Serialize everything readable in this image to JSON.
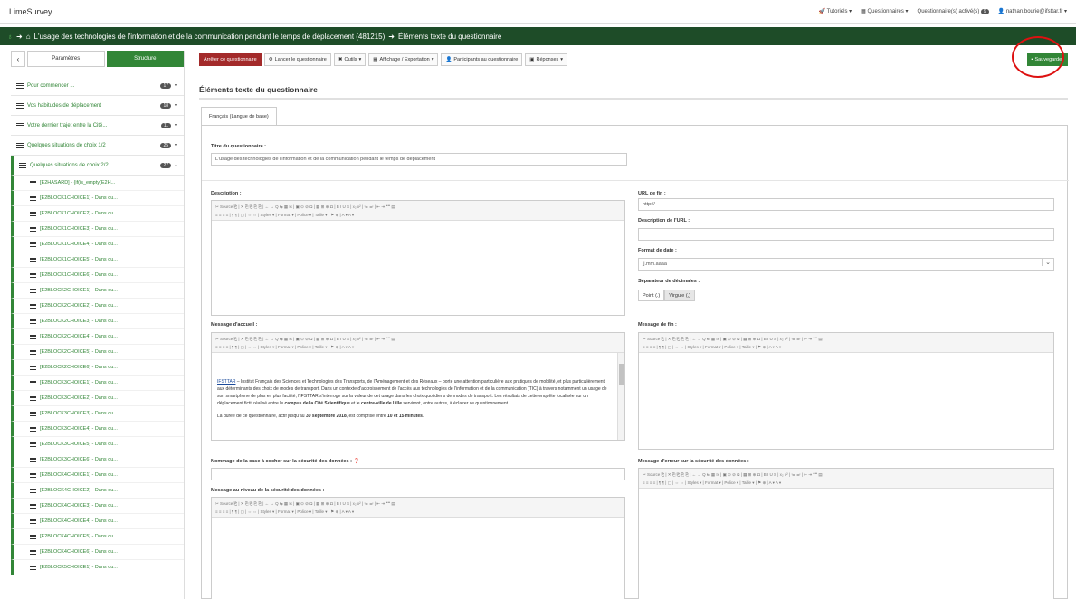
{
  "app": {
    "title": "LimeSurvey"
  },
  "topnav": {
    "tutorials": "Tutoriels",
    "surveys": "Questionnaires",
    "active": "Questionnaire(s) activé(s)",
    "active_count": "9",
    "user": "nathan.bourie@ifsttar.fr"
  },
  "breadcrumb": {
    "survey": "L'usage des technologies de l'information et de la communication pendant le temps de déplacement (481215)",
    "page": "Éléments texte du questionnaire"
  },
  "sidebar": {
    "tabs": [
      "Paramètres",
      "Structure"
    ],
    "groups": [
      {
        "label": "Pour commencer ...",
        "count": "17"
      },
      {
        "label": "Vos habitudes de déplacement",
        "count": "18"
      },
      {
        "label": "Votre dernier trajet entre la Cité...",
        "count": "11"
      },
      {
        "label": "Quelques situations de choix 1/2",
        "count": "25"
      },
      {
        "label": "Quelques situations de choix 2/2",
        "count": "27"
      }
    ],
    "questions": [
      "[E2HASARD] - {if(is_empty(E2H...",
      "[E2BLOCK1CHOICE1] - Dans qu...",
      "[E2BLOCK1CHOICE2] - Dans qu...",
      "[E2BLOCK1CHOICE3] - Dans qu...",
      "[E2BLOCK1CHOICE4] - Dans qu...",
      "[E2BLOCK1CHOICE5] - Dans qu...",
      "[E2BLOCK1CHOICE6] - Dans qu...",
      "[E2BLOCK2CHOICE1] - Dans qu...",
      "[E2BLOCK2CHOICE2] - Dans qu...",
      "[E2BLOCK2CHOICE3] - Dans qu...",
      "[E2BLOCK2CHOICE4] - Dans qu...",
      "[E2BLOCK2CHOICE5] - Dans qu...",
      "[E2BLOCK2CHOICE6] - Dans qu...",
      "[E2BLOCK3CHOICE1] - Dans qu...",
      "[E2BLOCK3CHOICE2] - Dans qu...",
      "[E2BLOCK3CHOICE3] - Dans qu...",
      "[E2BLOCK3CHOICE4] - Dans qu...",
      "[E2BLOCK3CHOICE5] - Dans qu...",
      "[E2BLOCK3CHOICE6] - Dans qu...",
      "[E2BLOCK4CHOICE1] - Dans qu...",
      "[E2BLOCK4CHOICE2] - Dans qu...",
      "[E2BLOCK4CHOICE3] - Dans qu...",
      "[E2BLOCK4CHOICE4] - Dans qu...",
      "[E2BLOCK4CHOICE5] - Dans qu...",
      "[E2BLOCK4CHOICE6] - Dans qu...",
      "[E2BLOCK5CHOICE1] - Dans qu..."
    ]
  },
  "toolbar": {
    "stop": "Arrêter ce questionnaire",
    "launch": "Lancer le questionnaire",
    "tools": "Outils",
    "display": "Affichage / Exportation",
    "participants": "Participants au questionnaire",
    "responses": "Réponses",
    "save": "Sauvegarder"
  },
  "main": {
    "section_title": "Éléments texte du questionnaire",
    "language_tab": "Français (Langue de base)",
    "title_label": "Titre du questionnaire :",
    "title_value": "L'usage des technologies de l'information et de la communication pendant le temps de déplacement",
    "description_label": "Description :",
    "end_url_label": "URL de fin :",
    "end_url_value": "http://",
    "url_desc_label": "Description de l'URL :",
    "date_format_label": "Format de date :",
    "date_format_value": "jj.mm.aaaa",
    "decimal_label": "Séparateur de décimales :",
    "decimal_point": "Point (.)",
    "decimal_comma": "Virgule (,)",
    "welcome_label": "Message d'accueil :",
    "end_message_label": "Message de fin :",
    "checkbox_label": "Nommage de la case à cocher sur la sécurité des données :",
    "security_message_label": "Message au niveau de la sécurité des données :",
    "security_error_label": "Message d'erreur sur la sécurité des données :"
  },
  "editor": {
    "row1": "✂ Source ⎗ | ✕ ⎘ ⎗ ⎘ ⎘ | ← → Q ⇆ ▦ Ix | ▣ ⊙ ⊘ Ω | ▦ ⊞ ⊕ Ω | B I U S | x₂ x² | ≔ ≕ | ⇤ ⇥ ❝❞ ▤",
    "row2": "≡ ≡ ≡ ≡ | ¶ ¶ | ▢ | ⇔ ⇔ | Styles ▾ | Format ▾ | Police ▾ | Taille ▾ | ⚑ ⊕ | A ▾ A ▾"
  },
  "welcome": {
    "link": "IFSTTAR",
    "p1": " – Institut Français des Sciences et Technologies des Transports, de l'Aménagement et des Réseaux – porte une attention particulière aux pratiques de mobilité, et plus particulièrement aux déterminants des choix de modes de transport. Dans un contexte d'accroissement de l'accès aux technologies de l'information et de la communication (TIC) à travers notamment un usage de son smartphone de plus en plus facilité, l'IFSTTAR s'interroge sur la valeur de cet usage dans les choix quotidiens de modes de transport. Les résultats de cette enquête focalisée sur un déplacement fictif réalisé entre le ",
    "b1": "campus de la Cité Scientifique",
    "p2": " et le ",
    "b2": "centre-ville de Lille",
    "p3": " serviront, entre autres, à éclairer ce questionnement.",
    "p4": "La durée de ce questionnaire, actif jusqu'au ",
    "b3": "30 septembre 2018",
    "p5": ", est comprise entre ",
    "b4": "10 et 15 minutes",
    "p6": "."
  }
}
